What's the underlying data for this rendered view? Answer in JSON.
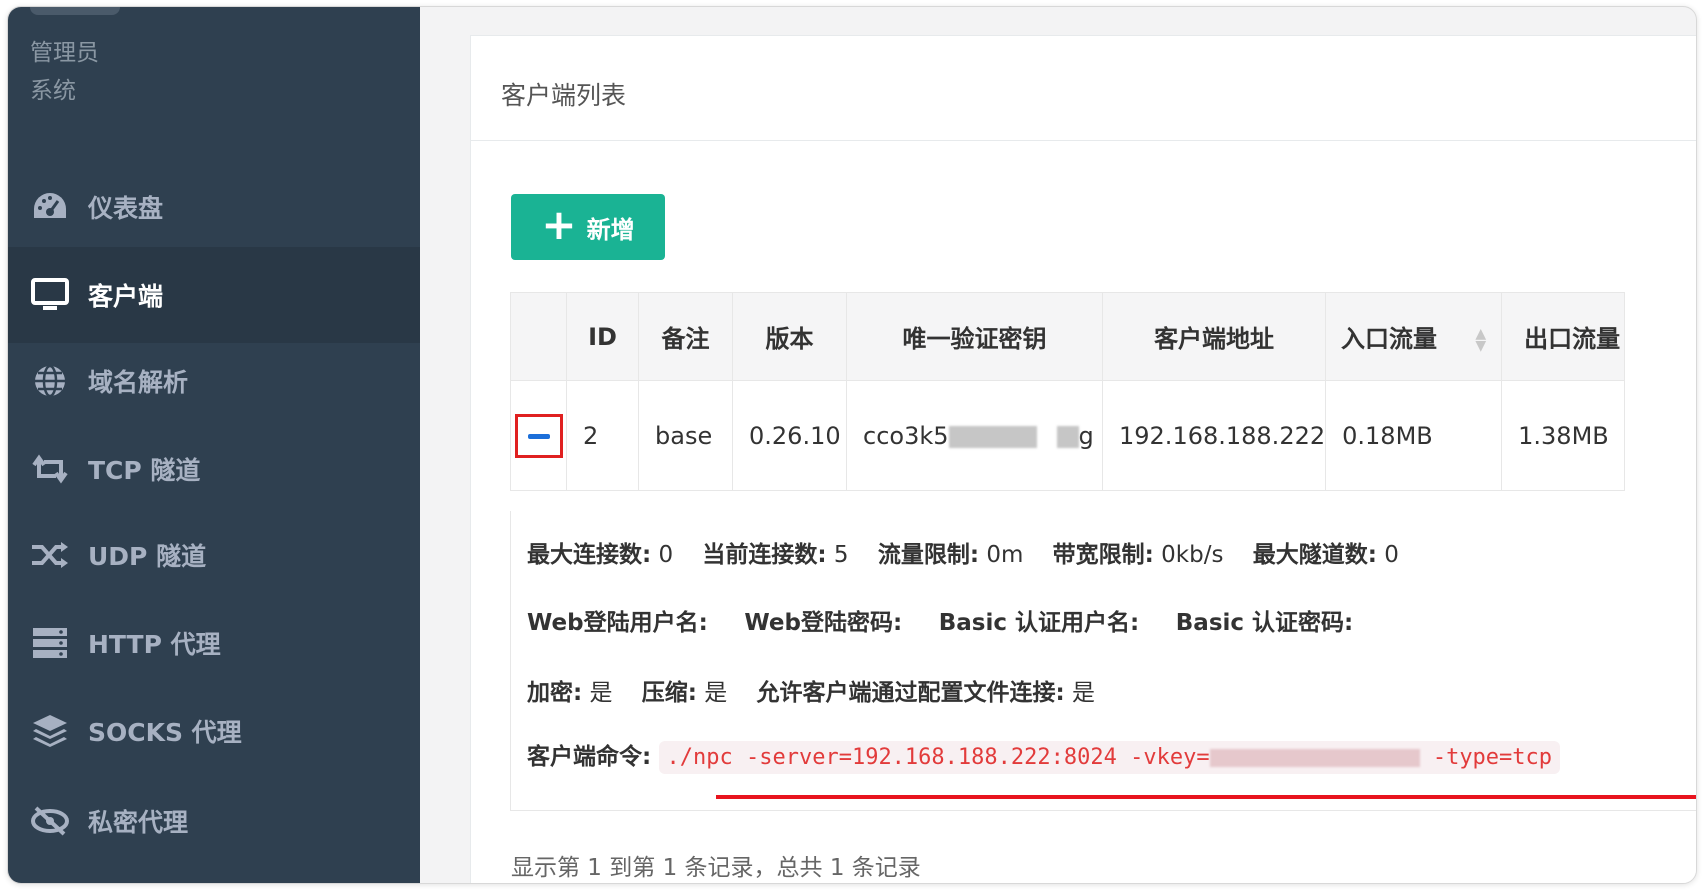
{
  "sidebar": {
    "user_role": "管理员",
    "user_sub": "系统",
    "items": [
      {
        "label": "仪表盘",
        "icon": "dashboard-icon"
      },
      {
        "label": "客户端",
        "icon": "monitor-icon"
      },
      {
        "label": "域名解析",
        "icon": "globe-icon"
      },
      {
        "label": "TCP 隧道",
        "icon": "retweet-icon"
      },
      {
        "label": "UDP 隧道",
        "icon": "random-icon"
      },
      {
        "label": "HTTP 代理",
        "icon": "server-icon"
      },
      {
        "label": "SOCKS 代理",
        "icon": "layers-icon"
      },
      {
        "label": "私密代理",
        "icon": "eye-slash-icon"
      }
    ],
    "active_index": 1
  },
  "main": {
    "title": "客户端列表",
    "add_button": "新增",
    "table": {
      "headers": [
        "",
        "ID",
        "备注",
        "版本",
        "唯一验证密钥",
        "客户端地址",
        "入口流量",
        "出口流量"
      ],
      "rows": [
        {
          "id": "2",
          "remark": "base",
          "version": "0.26.10",
          "key_start": "cco3k5",
          "key_end": "g",
          "address": "192.168.188.222",
          "in_flow": "0.18MB",
          "out_flow": "1.38MB"
        }
      ]
    },
    "detail": {
      "max_conn_label": "最大连接数:",
      "max_conn": "0",
      "cur_conn_label": "当前连接数:",
      "cur_conn": "5",
      "flow_limit_label": "流量限制:",
      "flow_limit": "0m",
      "bw_limit_label": "带宽限制:",
      "bw_limit": "0kb/s",
      "max_tunnel_label": "最大隧道数:",
      "max_tunnel": "0",
      "web_user_label": "Web登陆用户名:",
      "web_pass_label": "Web登陆密码:",
      "basic_user_label": "Basic 认证用户名:",
      "basic_pass_label": "Basic 认证密码:",
      "encrypt_label": "加密:",
      "encrypt": "是",
      "compress_label": "压缩:",
      "compress": "是",
      "config_conn_label": "允许客户端通过配置文件连接:",
      "config_conn": "是",
      "cmd_label": "客户端命令:",
      "cmd_prefix": "./npc -server=192.168.188.222:8024 -vkey=",
      "cmd_suffix": " -type=tcp"
    },
    "footer": "显示第 1 到第 1 条记录，总共 1 条记录"
  },
  "colors": {
    "sidebar_bg": "#2f4050",
    "sidebar_active": "#293846",
    "primary": "#1ab394",
    "highlight_red": "#e8141e"
  }
}
